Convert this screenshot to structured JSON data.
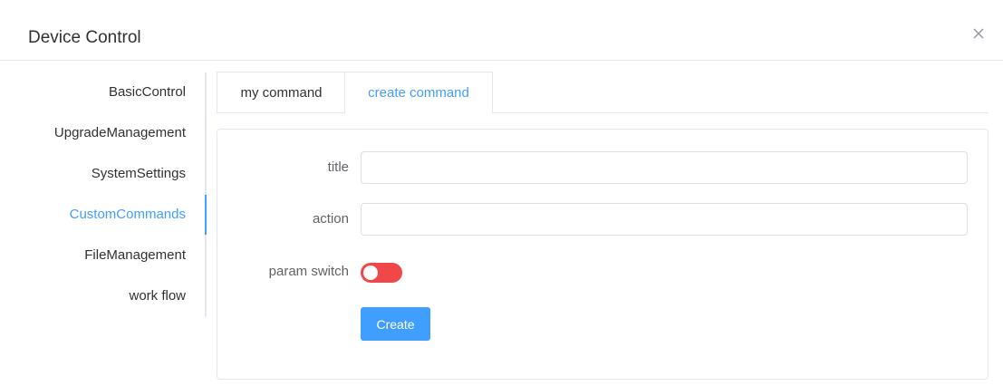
{
  "dialog": {
    "title": "Device Control",
    "close_icon": "close-icon"
  },
  "sidebar": {
    "items": [
      {
        "label": "BasicControl"
      },
      {
        "label": "UpgradeManagement"
      },
      {
        "label": "SystemSettings"
      },
      {
        "label": "CustomCommands",
        "active": true
      },
      {
        "label": "FileManagement"
      },
      {
        "label": "work flow"
      }
    ]
  },
  "tabs": [
    {
      "label": "my command"
    },
    {
      "label": "create command",
      "active": true
    }
  ],
  "form": {
    "title_label": "title",
    "title_value": "",
    "action_label": "action",
    "action_value": "",
    "param_switch_label": "param switch",
    "param_switch_on": false,
    "create_label": "Create"
  },
  "colors": {
    "accent": "#409eff",
    "switch": "#f04848"
  }
}
